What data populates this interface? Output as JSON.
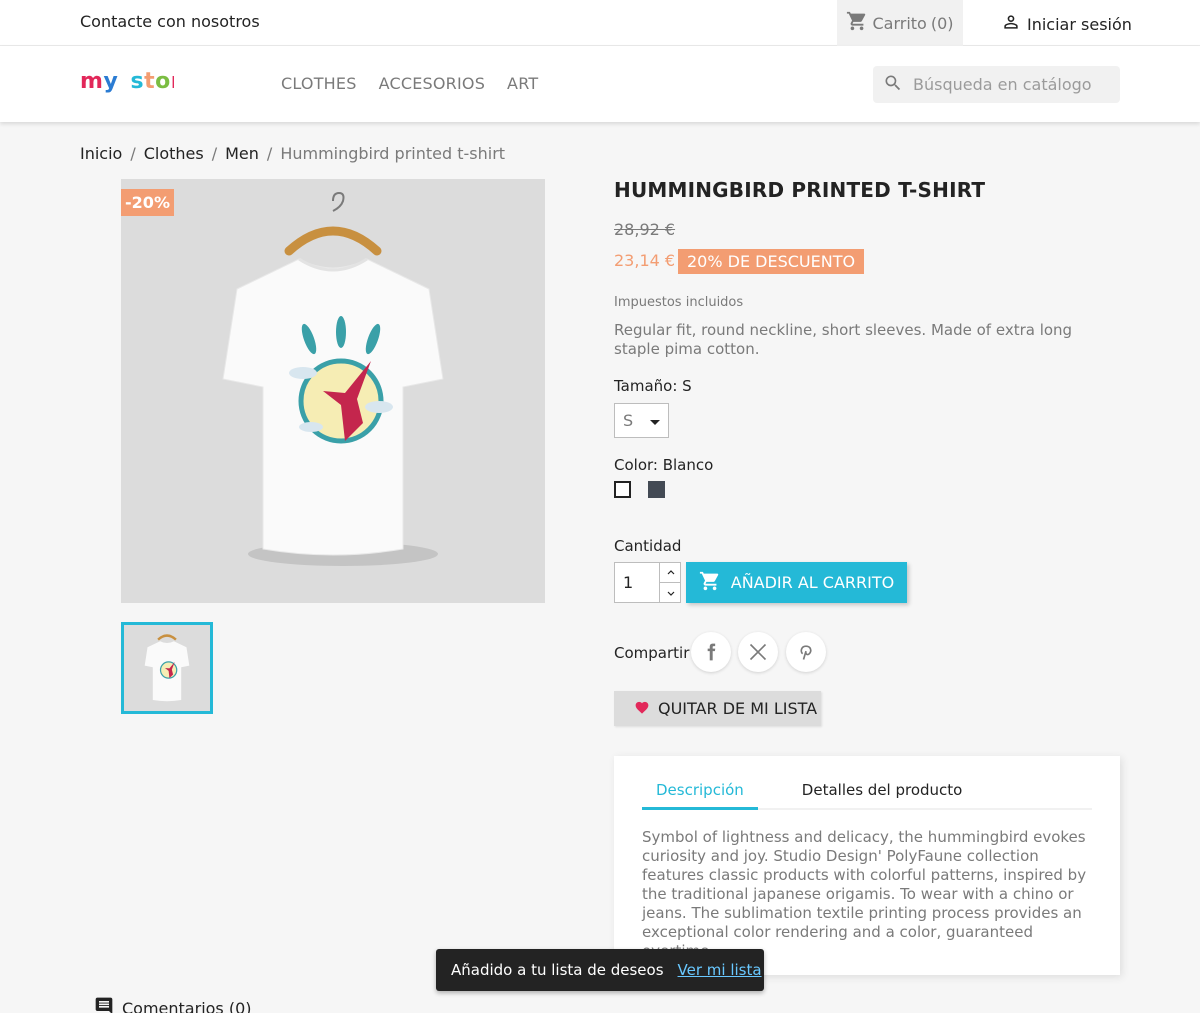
{
  "topbar": {
    "contact": "Contacte con nosotros",
    "cart_label": "Carrito",
    "cart_count": "(0)",
    "signin": "Iniciar sesión"
  },
  "logo": {
    "part1": "my",
    "part2": "store"
  },
  "menu": [
    "CLOTHES",
    "ACCESORIOS",
    "ART"
  ],
  "search": {
    "placeholder": "Búsqueda en catálogo"
  },
  "breadcrumb": [
    "Inicio",
    "Clothes",
    "Men",
    "Hummingbird printed t-shirt"
  ],
  "breadcrumb_separator": "/",
  "product": {
    "discount_flag": "-20%",
    "title": "HUMMINGBIRD PRINTED T-SHIRT",
    "old_price": "28,92 €",
    "price": "23,14 €",
    "discount_badge": "20% DE DESCUENTO",
    "tax": "Impuestos incluidos",
    "short_description": "Regular fit, round neckline, short sleeves. Made of extra long staple pima cotton.",
    "size_label": "Tamaño: S",
    "size_value": "S",
    "color_label": "Color: Blanco",
    "colors": [
      "#ffffff",
      "#434a54"
    ],
    "qty_label": "Cantidad",
    "qty_value": "1",
    "add_to_cart": "AÑADIR AL CARRITO",
    "share_label": "Compartir",
    "wishlist_button": "QUITAR DE MI LISTA",
    "accent_color": "#24b9d7",
    "discount_color": "#f39d72"
  },
  "tabs": {
    "items": [
      "Descripción",
      "Detalles del producto"
    ],
    "active": "Descripción",
    "description": "Symbol of lightness and delicacy, the hummingbird evokes curiosity and joy. Studio Design' PolyFaune collection features classic products with colorful patterns, inspired by the traditional japanese origamis. To wear with a chino or jeans. The sublimation textile printing process provides an exceptional color rendering and a color, guaranteed overtime."
  },
  "toast": {
    "message": "Añadido a tu lista de deseos",
    "link": "Ver mi lista"
  },
  "comments": "Comentarios (0)"
}
